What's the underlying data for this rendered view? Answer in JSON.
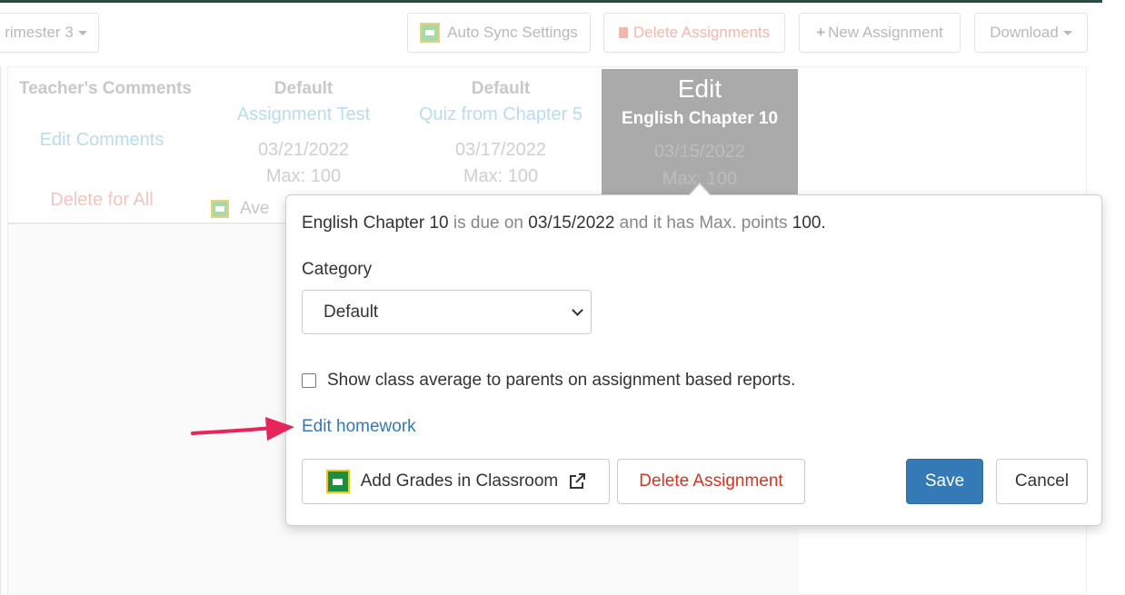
{
  "toolbar": {
    "term_select": "rimester 3",
    "auto_sync": "Auto Sync Settings",
    "delete_assignments": "Delete Assignments",
    "new_assignment": "New Assignment",
    "download": "Download"
  },
  "grid": {
    "teacher_comments_header": "Teacher's Comments",
    "edit_comments": "Edit Comments",
    "delete_for_all": "Delete for All",
    "average_partial": "Ave",
    "columns": [
      {
        "category": "Default",
        "name": "Assignment Test",
        "date": "03/21/2022",
        "max": "Max: 100"
      },
      {
        "category": "Default",
        "name": "Quiz from Chapter 5",
        "date": "03/17/2022",
        "max": "Max: 100"
      }
    ],
    "edit_column": {
      "overlay": "Edit",
      "name": "English Chapter 10",
      "date": "03/15/2022",
      "max": "Max: 100"
    }
  },
  "popover": {
    "assignment_name": "English Chapter 10",
    "due_text": "is due on",
    "due_date": "03/15/2022",
    "points_text": "and it has Max. points",
    "max_points": "100.",
    "category_label": "Category",
    "category_value": "Default",
    "show_average_label": "Show class average to parents on assignment based reports.",
    "edit_homework": "Edit homework",
    "add_grades": "Add Grades in Classroom",
    "delete_assignment": "Delete Assignment",
    "save": "Save",
    "cancel": "Cancel"
  },
  "colors": {
    "primary": "#337ab7",
    "danger": "#d9331f",
    "annotation_arrow": "#e8255a"
  }
}
